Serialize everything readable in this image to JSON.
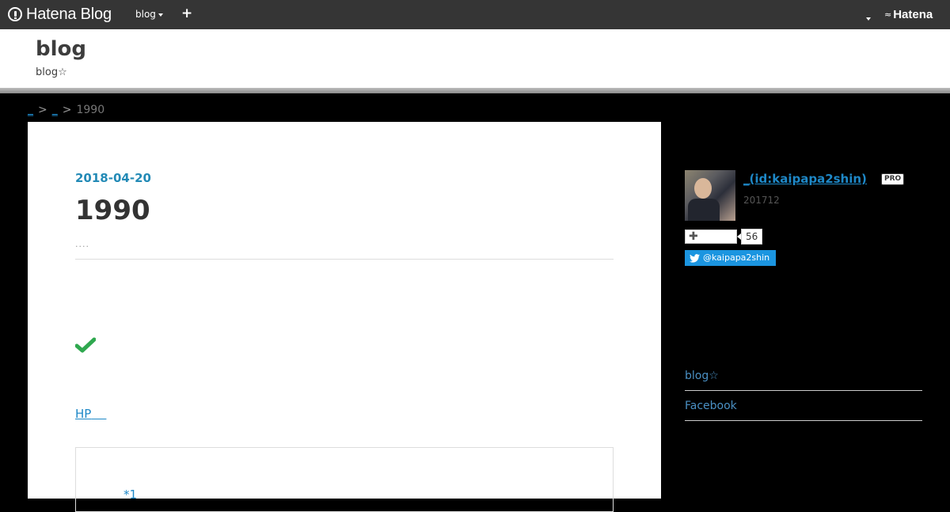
{
  "topbar": {
    "brand": "Hatena Blog",
    "blog_menu": "blog",
    "plus": "+",
    "hatena": "Hatena"
  },
  "header": {
    "title": "blog",
    "description": "blog☆"
  },
  "breadcrumb": {
    "items": [
      "_",
      "_"
    ],
    "separator": ">",
    "current": "1990"
  },
  "entry": {
    "date": "2018-04-20",
    "title": "1990",
    "tags": "....",
    "hp_link": "HP",
    "footnote": "*1"
  },
  "sidebar": {
    "author": "_(id:kaipapa2shin)",
    "pro": "PRO",
    "since": "201712",
    "follow_count": "56",
    "twitter": "@kaipapa2shin",
    "links": [
      "blog☆",
      "Facebook"
    ]
  },
  "colors": {
    "link": "#1e88c7",
    "date": "#238ab6",
    "topbar": "#353535",
    "twitter": "#1b95e0",
    "check": "#2fa84f"
  }
}
